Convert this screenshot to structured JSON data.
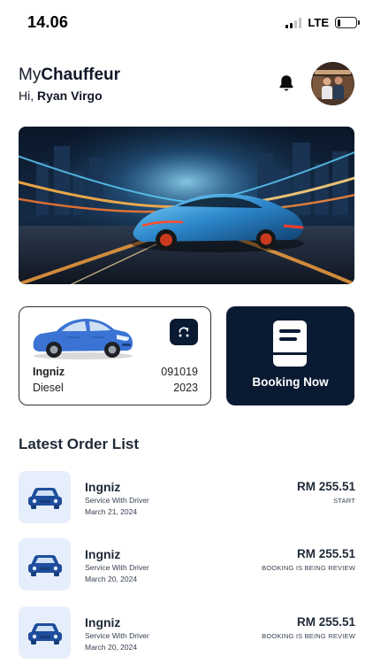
{
  "status_bar": {
    "time": "14.06",
    "network": "LTE",
    "battery_percent": 15
  },
  "header": {
    "app_name_prefix": "My",
    "app_name_bold": "Chauffeur",
    "greeting_prefix": "Hi, ",
    "user_name": "Ryan Virgo"
  },
  "icons": {
    "bell": "bell-icon",
    "swap": "swap-vehicle-icon",
    "booking": "document-icon",
    "car": "car-icon"
  },
  "vehicle": {
    "model": "Ingniz",
    "plate": "091019",
    "fuel": "Diesel",
    "year": "2023"
  },
  "booking": {
    "label": "Booking Now"
  },
  "orders_section": {
    "title": "Latest Order List"
  },
  "orders": [
    {
      "name": "Ingniz",
      "service": "Service With Driver",
      "date": "March 21, 2024",
      "price": "RM 255.51",
      "status": "START"
    },
    {
      "name": "Ingniz",
      "service": "Service With Driver",
      "date": "March 20, 2024",
      "price": "RM 255.51",
      "status": "BOOKING IS BEING REVIEW"
    },
    {
      "name": "Ingniz",
      "service": "Service With Driver",
      "date": "March 20, 2024",
      "price": "RM 255.51",
      "status": "BOOKING IS BEING REVIEW"
    }
  ],
  "colors": {
    "navy": "#0b1a33",
    "thumb_bg": "#e7eefb",
    "car_blue": "#1e4e9c"
  }
}
